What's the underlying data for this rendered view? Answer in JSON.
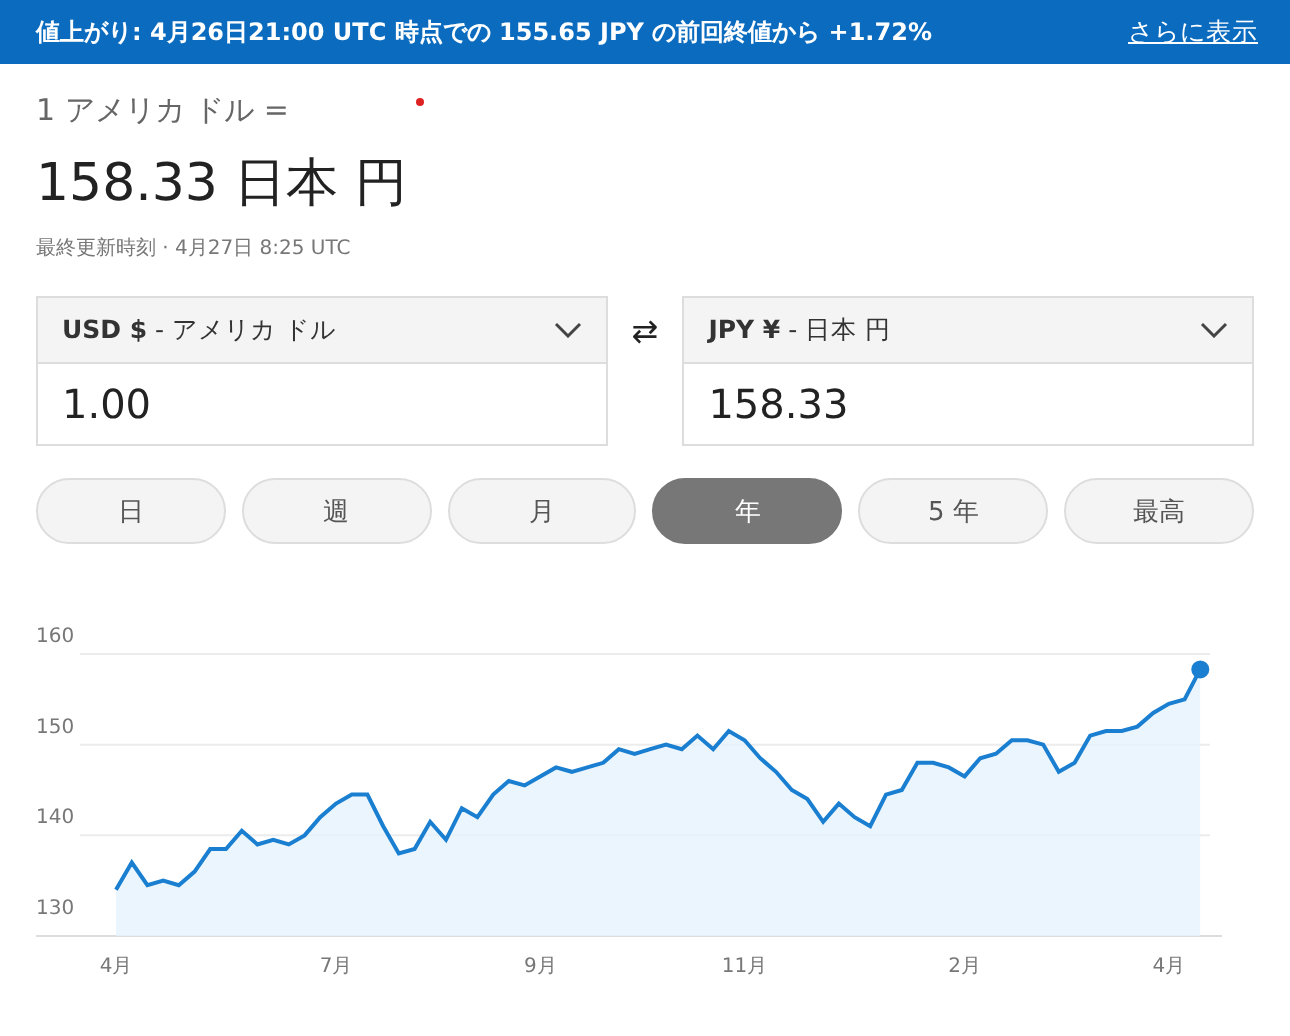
{
  "banner": {
    "text": "値上がり: 4月26日21:00 UTC 時点での 155.65 JPY の前回終値から +1.72%",
    "link": "さらに表示"
  },
  "rate": {
    "from_label": "1 アメリカ ドル =",
    "value": "158.33 日本 円",
    "updated": "最終更新時刻 · 4月27日 8:25 UTC"
  },
  "converters": [
    {
      "code": "USD $",
      "name": " - アメリカ ドル",
      "amount": "1.00"
    },
    {
      "code": "JPY ¥",
      "name": " - 日本 円",
      "amount": "158.33"
    }
  ],
  "swap_icon": "⇄",
  "ranges": [
    {
      "label": "日",
      "selected": false
    },
    {
      "label": "週",
      "selected": false
    },
    {
      "label": "月",
      "selected": false
    },
    {
      "label": "年",
      "selected": true
    },
    {
      "label": "5 年",
      "selected": false
    },
    {
      "label": "最高",
      "selected": false
    }
  ],
  "chart_data": {
    "type": "area",
    "ylim": [
      130,
      160
    ],
    "yticks": [
      130,
      140,
      150,
      160
    ],
    "categories": [
      "4月",
      null,
      null,
      null,
      null,
      null,
      null,
      null,
      null,
      null,
      null,
      null,
      null,
      null,
      "7月",
      null,
      null,
      null,
      null,
      null,
      null,
      null,
      null,
      null,
      null,
      null,
      null,
      "9月",
      null,
      null,
      null,
      null,
      null,
      null,
      null,
      null,
      null,
      null,
      null,
      null,
      "11月",
      null,
      null,
      null,
      null,
      null,
      null,
      null,
      null,
      null,
      null,
      null,
      null,
      null,
      "2月",
      null,
      null,
      null,
      null,
      null,
      null,
      null,
      null,
      null,
      null,
      null,
      null,
      "4月",
      null,
      null
    ],
    "series": [
      {
        "color": "#1a7fd0",
        "values": [
          134,
          137,
          134.5,
          135,
          134.5,
          136,
          138.5,
          138.5,
          140.5,
          139,
          139.5,
          139,
          140,
          142,
          143.5,
          144.5,
          144.5,
          141,
          138,
          138.5,
          141.5,
          139.5,
          143,
          142,
          144.5,
          146,
          145.5,
          146.5,
          147.5,
          147,
          147.5,
          148,
          149.5,
          149,
          149.5,
          150,
          149.5,
          151,
          149.5,
          151.5,
          150.5,
          148.5,
          147,
          145,
          144,
          141.5,
          143.5,
          142,
          141,
          144.5,
          145,
          148,
          148,
          147.5,
          146.5,
          148.5,
          149,
          150.5,
          150.5,
          150,
          147,
          148,
          151,
          151.5,
          151.5,
          152,
          153.5,
          154.5,
          155,
          158.3
        ]
      }
    ]
  }
}
